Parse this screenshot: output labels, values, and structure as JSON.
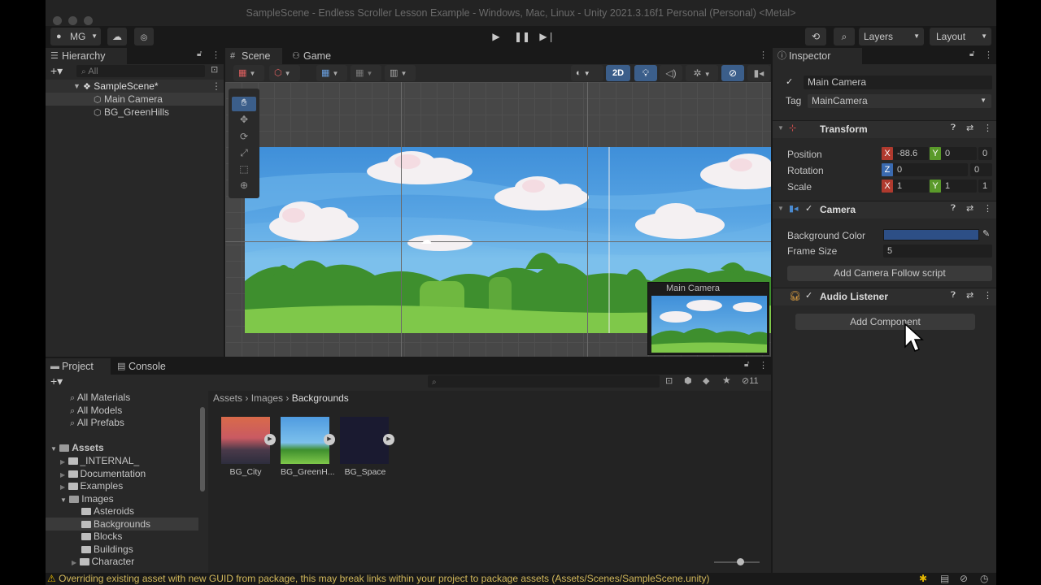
{
  "window": {
    "title": "SampleScene - Endless Scroller Lesson Example - Windows, Mac, Linux - Unity 2021.3.16f1 Personal (Personal) <Metal>"
  },
  "toolbar": {
    "account": "MG",
    "layers": "Layers",
    "layout": "Layout"
  },
  "hierarchy": {
    "tab": "Hierarchy",
    "search_placeholder": "All",
    "scene": "SampleScene*",
    "items": [
      "Main Camera",
      "BG_GreenHills"
    ]
  },
  "scene_view": {
    "tabs": [
      "Scene",
      "Game"
    ],
    "mode_2d": "2D",
    "camera_preview_title": "Main Camera"
  },
  "project": {
    "tabs": [
      "Project",
      "Console"
    ],
    "hidden_count": "11",
    "favorites": [
      "All Materials",
      "All Models",
      "All Prefabs"
    ],
    "tree_root": "Assets",
    "tree": [
      "_INTERNAL_",
      "Documentation",
      "Examples",
      "Images",
      "Asteroids",
      "Backgrounds",
      "Blocks",
      "Buildings",
      "Character"
    ],
    "breadcrumb": [
      "Assets",
      "Images",
      "Backgrounds"
    ],
    "assets": [
      "BG_City",
      "BG_GreenH...",
      "BG_Space"
    ]
  },
  "inspector": {
    "tab": "Inspector",
    "object_name": "Main Camera",
    "tag_label": "Tag",
    "tag_value": "MainCamera",
    "transform": {
      "title": "Transform",
      "position_label": "Position",
      "pos_x": "-88.6",
      "pos_y": "0",
      "pos_z": "0",
      "rotation_label": "Rotation",
      "rot_z": "0",
      "rot_extra": "0",
      "scale_label": "Scale",
      "scale_x": "1",
      "scale_y": "1",
      "scale_z": "1"
    },
    "camera": {
      "title": "Camera",
      "bg_color_label": "Background Color",
      "bg_color": "#2d4f86",
      "frame_size_label": "Frame Size",
      "frame_size": "5",
      "follow_button": "Add Camera Follow script"
    },
    "audio": {
      "title": "Audio Listener"
    },
    "add_component": "Add Component"
  },
  "status": {
    "message": "Overriding existing asset with new GUID from package, this may break links within your project to package assets (Assets/Scenes/SampleScene.unity)"
  },
  "axis_labels": {
    "x": "X",
    "y": "Y",
    "z": "Z"
  },
  "colors": {
    "sky": "#4f9be0",
    "grass": "#6fbe45",
    "panel": "#282828",
    "accent": "#2d4f86"
  }
}
